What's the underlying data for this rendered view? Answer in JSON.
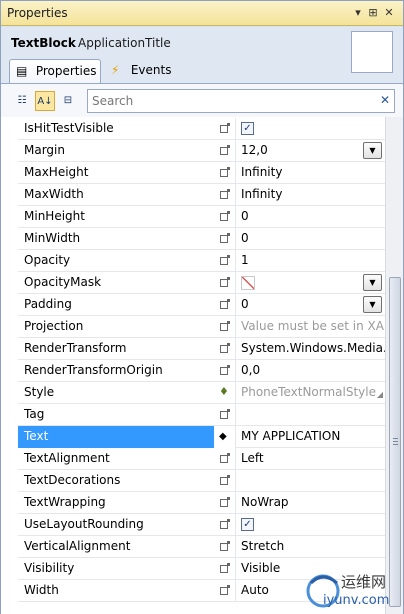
{
  "window": {
    "title": "Properties",
    "pin_icon": "pin-icon",
    "close_icon": "close-icon"
  },
  "header": {
    "type_name": "TextBlock",
    "object_name": "ApplicationTitle",
    "tabs": [
      {
        "label": "Properties",
        "icon": "properties-icon",
        "active": true
      },
      {
        "label": "Events",
        "icon": "lightning-icon",
        "active": false
      }
    ]
  },
  "toolbar": {
    "categorized_icon": "categorized-icon",
    "alphabetical_icon": "sort-az-icon",
    "property_pages_icon": "property-pages-icon",
    "search_placeholder": "Search",
    "search_value": "",
    "clear_icon": "clear-icon"
  },
  "rows": [
    {
      "name": "IsHitTestVisible",
      "value": "",
      "checkbox": true
    },
    {
      "name": "Margin",
      "value": "12,0",
      "dropdown": true
    },
    {
      "name": "MaxHeight",
      "value": "Infinity"
    },
    {
      "name": "MaxWidth",
      "value": "Infinity"
    },
    {
      "name": "MinHeight",
      "value": "0"
    },
    {
      "name": "MinWidth",
      "value": "0"
    },
    {
      "name": "Opacity",
      "value": "1"
    },
    {
      "name": "OpacityMask",
      "value": "",
      "dropdown": true,
      "nobrush": true
    },
    {
      "name": "Padding",
      "value": "0",
      "dropdown": true
    },
    {
      "name": "Projection",
      "value": "Value must be set in XAML",
      "grey": true
    },
    {
      "name": "RenderTransform",
      "value": "System.Windows.Media.TranslateTransform"
    },
    {
      "name": "RenderTransformOrigin",
      "value": "0,0"
    },
    {
      "name": "Style",
      "value": "PhoneTextNormalStyle",
      "grey": true,
      "resource": true
    },
    {
      "name": "Tag",
      "value": ""
    },
    {
      "name": "Text",
      "value": "MY APPLICATION",
      "selected": true,
      "local": true
    },
    {
      "name": "TextAlignment",
      "value": "Left"
    },
    {
      "name": "TextDecorations",
      "value": ""
    },
    {
      "name": "TextWrapping",
      "value": "NoWrap"
    },
    {
      "name": "UseLayoutRounding",
      "value": "",
      "checkbox": true
    },
    {
      "name": "VerticalAlignment",
      "value": "Stretch"
    },
    {
      "name": "Visibility",
      "value": "Visible"
    },
    {
      "name": "Width",
      "value": "Auto"
    }
  ],
  "watermark": {
    "cn": "运维网",
    "url": "iyunv.com"
  }
}
